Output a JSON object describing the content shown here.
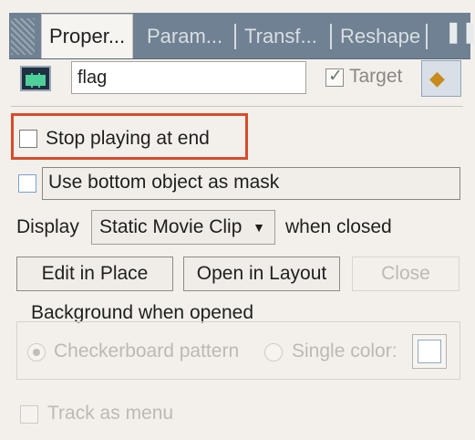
{
  "tabs": [
    "Proper...",
    "Param...",
    "Transf...",
    "Reshape"
  ],
  "symbol": {
    "name_value": "flag",
    "target_label": "Target",
    "target_checked": true,
    "target_tick": "✓"
  },
  "options": {
    "stop_playing_label": "Stop playing at end",
    "use_mask_label": "Use bottom object as mask",
    "display_label": "Display",
    "display_select_value": "Static Movie Clip",
    "display_select_caret": "▼",
    "when_closed_label": "when closed"
  },
  "buttons": {
    "edit_in_place": "Edit in Place",
    "open_in_layout": "Open in Layout",
    "close": "Close"
  },
  "background_group": {
    "title": "Background when opened",
    "checkerboard_label": "Checkerboard pattern",
    "single_color_label": "Single color:",
    "selected": "checkerboard"
  },
  "track_as_menu_label": "Track as menu",
  "colors": {
    "highlight": "#d94b2a",
    "tabstrip": "#6f8192",
    "panel_bg": "#f3f0eb"
  },
  "icons": [
    "grip-icon",
    "movie-clip-icon",
    "layers-icon",
    "panel-menu-icon",
    "dropdown-caret-icon"
  ]
}
